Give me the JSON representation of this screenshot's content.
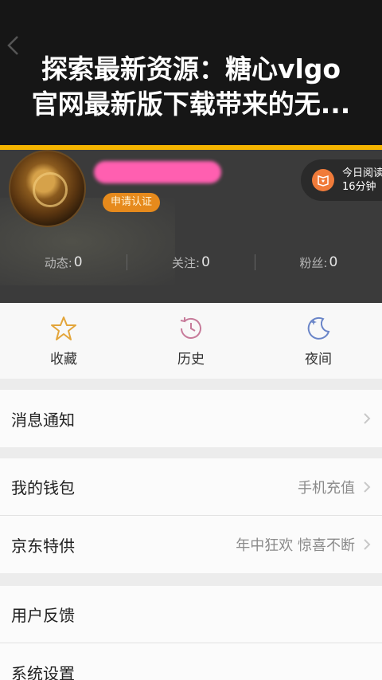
{
  "header": {
    "title_line1": "探索最新资源：糖心vlgo",
    "title_line2": "官网最新版下载带来的无..."
  },
  "profile": {
    "verify_badge": "申请认证",
    "reading_label": "今日阅读",
    "reading_time": "16分钟",
    "stats": [
      {
        "label": "动态:",
        "value": "0"
      },
      {
        "label": "关注:",
        "value": "0"
      },
      {
        "label": "粉丝:",
        "value": "0"
      }
    ]
  },
  "quick_actions": [
    {
      "label": "收藏",
      "icon": "star-icon"
    },
    {
      "label": "历史",
      "icon": "history-clock-icon"
    },
    {
      "label": "夜间",
      "icon": "moon-icon"
    }
  ],
  "menu": {
    "notifications": {
      "label": "消息通知"
    },
    "wallet": {
      "label": "我的钱包",
      "hint": "手机充值"
    },
    "jd": {
      "label": "京东特供",
      "hint": "年中狂欢 惊喜不断"
    },
    "feedback": {
      "label": "用户反馈"
    },
    "settings": {
      "label": "系统设置"
    }
  },
  "colors": {
    "accent_bar": "#f4b400",
    "badge": "#e68a1c",
    "icon_blue": "#6a85c8"
  }
}
